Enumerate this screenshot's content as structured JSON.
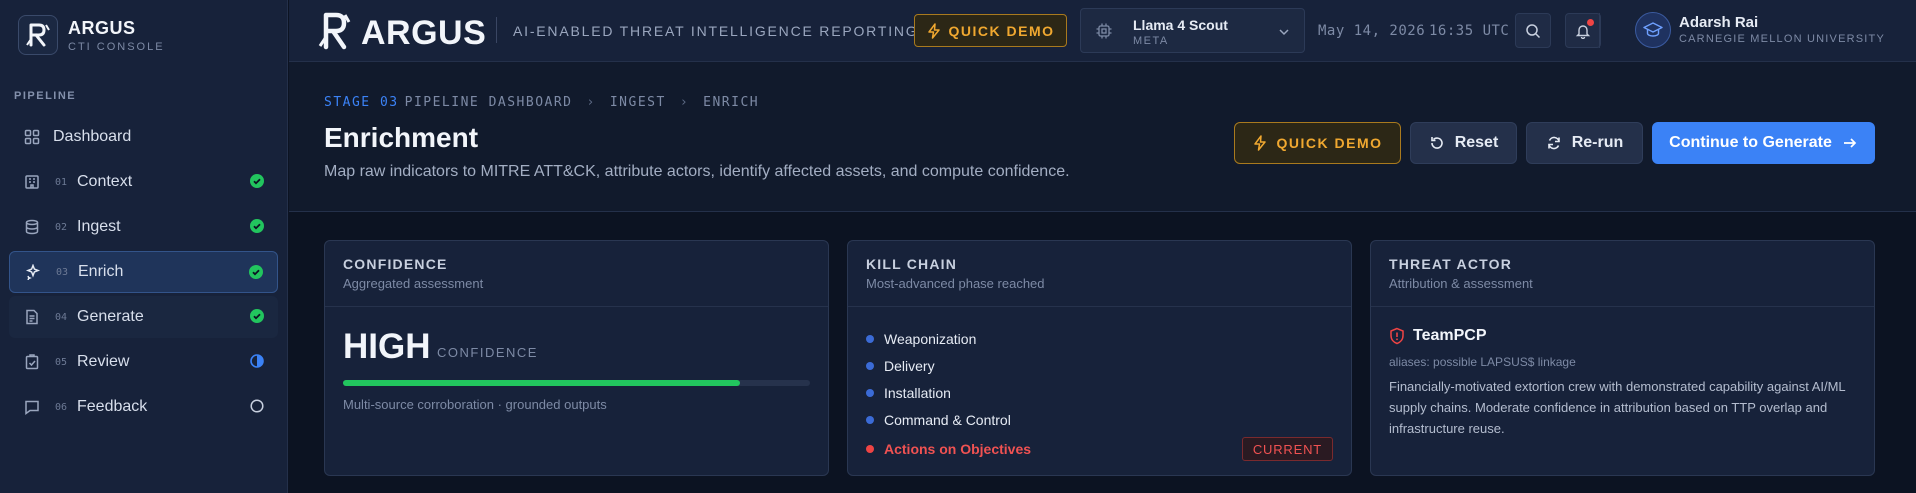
{
  "brand": {
    "title": "ARGUS",
    "subtitle": "CTI CONSOLE"
  },
  "sidebar": {
    "section_label": "PIPELINE",
    "items": [
      {
        "num": "",
        "label": "Dashboard",
        "icon": "grid-icon",
        "status": "none"
      },
      {
        "num": "01",
        "label": "Context",
        "icon": "building-icon",
        "status": "complete"
      },
      {
        "num": "02",
        "label": "Ingest",
        "icon": "database-icon",
        "status": "complete"
      },
      {
        "num": "03",
        "label": "Enrich",
        "icon": "sparkle-icon",
        "status": "complete"
      },
      {
        "num": "04",
        "label": "Generate",
        "icon": "document-icon",
        "status": "complete"
      },
      {
        "num": "05",
        "label": "Review",
        "icon": "clipboard-icon",
        "status": "in-progress"
      },
      {
        "num": "06",
        "label": "Feedback",
        "icon": "message-icon",
        "status": "pending"
      }
    ]
  },
  "topbar": {
    "title": "ARGUS",
    "tagline": "AI-ENABLED THREAT INTELLIGENCE REPORTING",
    "demo_label": "QUICK DEMO",
    "model": {
      "name": "Llama 4 Scout",
      "vendor": "META"
    },
    "date": "May 14, 2026",
    "time": "16:35 UTC",
    "user": {
      "name": "Adarsh Rai",
      "org": "CARNEGIE MELLON UNIVERSITY"
    }
  },
  "header": {
    "breadcrumb": {
      "stage": "STAGE 03",
      "items": [
        "PIPELINE DASHBOARD",
        "INGEST",
        "ENRICH"
      ]
    },
    "title": "Enrichment",
    "subtitle": "Map raw indicators to MITRE ATT&CK, attribute actors, identify affected assets, and compute confidence.",
    "buttons": {
      "demo": "QUICK DEMO",
      "reset": "Reset",
      "rerun": "Re-run",
      "continue": "Continue to Generate"
    }
  },
  "cards": {
    "confidence": {
      "title": "CONFIDENCE",
      "subtitle": "Aggregated assessment",
      "level": "HIGH",
      "level_suffix": "CONFIDENCE",
      "progress_fraction": 0.85,
      "note": "Multi-source corroboration · grounded outputs"
    },
    "kill_chain": {
      "title": "KILL CHAIN",
      "subtitle": "Most-advanced phase reached",
      "phases": [
        "Weaponization",
        "Delivery",
        "Installation",
        "Command & Control"
      ],
      "current_phase": "Actions on Objectives",
      "current_badge": "CURRENT"
    },
    "threat_actor": {
      "title": "THREAT ACTOR",
      "subtitle": "Attribution & assessment",
      "name": "TeamPCP",
      "aliases": "aliases: possible LAPSUS$ linkage",
      "description": "Financially-motivated extortion crew with demonstrated capability against AI/ML supply chains. Moderate confidence in attribution based on TTP overlap and infrastructure reuse."
    }
  },
  "colors": {
    "accent": "#3b82f6",
    "success": "#22c55e",
    "warning": "#f0a830",
    "danger": "#ef4444",
    "background": "#0c1322"
  }
}
